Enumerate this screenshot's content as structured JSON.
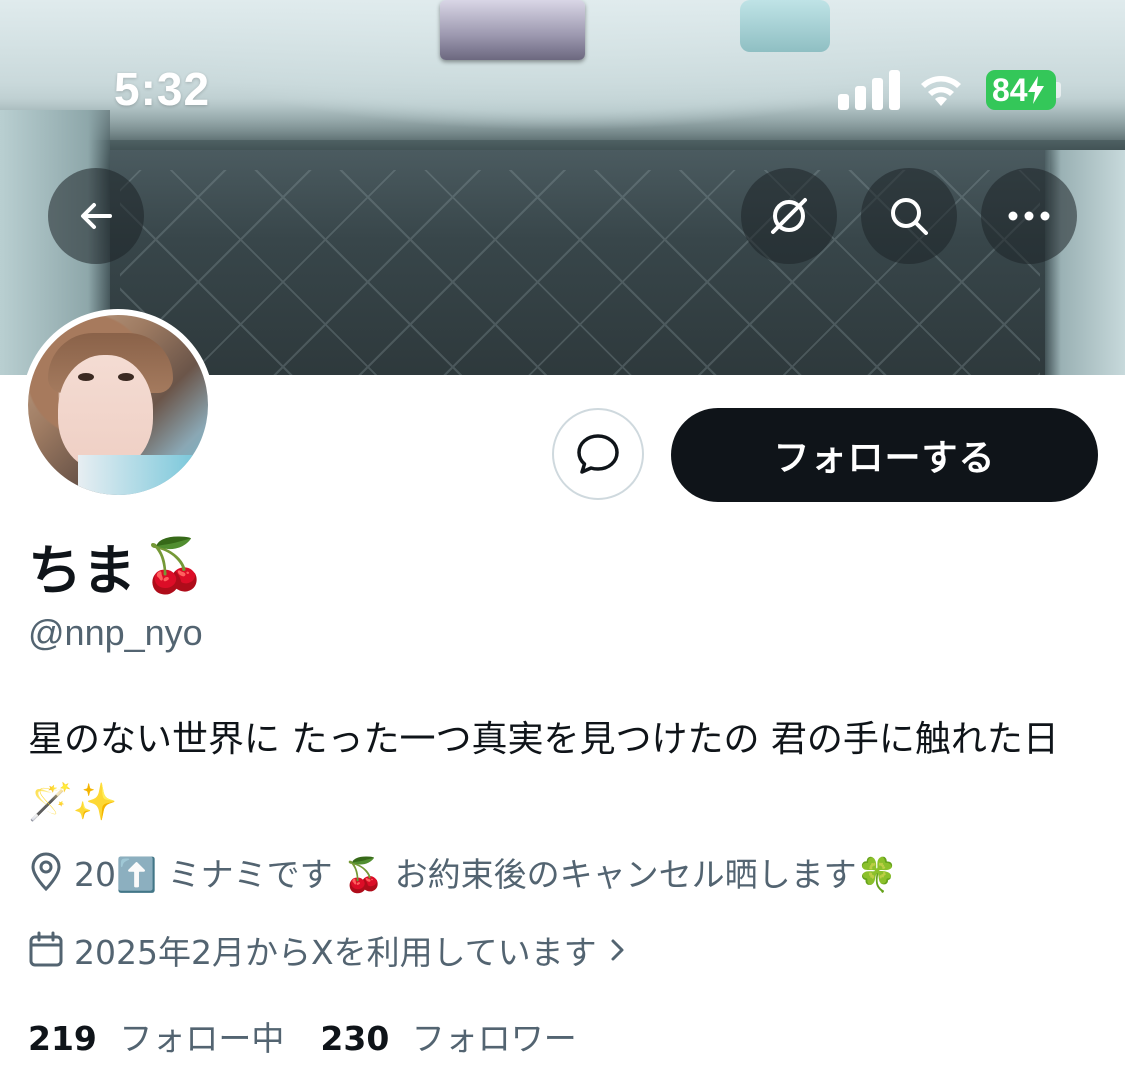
{
  "status_bar": {
    "time": "5:32",
    "battery": "84",
    "battery_color": "#34c759"
  },
  "header": {
    "back_icon": "arrow-left-icon",
    "grok_icon": "slash-circle-icon",
    "search_icon": "search-icon",
    "more_icon": "more-horizontal-icon"
  },
  "profile": {
    "display_name": "ちま",
    "name_emoji": "🍒",
    "handle": "@nnp_nyo",
    "bio": "星のない世界に たった一つ真実を見つけたの 君の手に触れた日🪄✨",
    "location": "20⬆️ ミナミです 🍒 お約束後のキャンセル晒します🍀",
    "joined": "2025年2月からXを利用しています",
    "following_count": "219",
    "following_label": "フォロー中",
    "followers_count": "230",
    "followers_label": "フォロワー"
  },
  "actions": {
    "follow_label": "フォローする",
    "message_icon": "message-bubble-icon"
  },
  "colors": {
    "primary_text": "#0f1419",
    "secondary_text": "#536471",
    "follow_button_bg": "#0f1419"
  }
}
